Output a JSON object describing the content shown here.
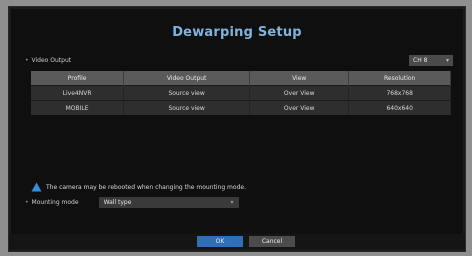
{
  "title": "Dewarping Setup",
  "video_output_label": "Video Output",
  "channel_select": {
    "value": "CH 8"
  },
  "table": {
    "headers": [
      "Profile",
      "Video Output",
      "View",
      "Resolution"
    ],
    "rows": [
      [
        "Live4NVR",
        "Source view",
        "Over View",
        "768x768"
      ],
      [
        "MOBILE",
        "Source view",
        "Over View",
        "640x640"
      ]
    ]
  },
  "warning_text": "The camera may be rebooted when changing the mounting mode.",
  "mounting_mode": {
    "label": "Mounting mode",
    "value": "Wall type"
  },
  "buttons": {
    "ok": "OK",
    "cancel": "Cancel"
  },
  "colors": {
    "title": "#7fb3df",
    "ok_button": "#2f6fb8",
    "warning_icon": "#2f8fd8"
  }
}
